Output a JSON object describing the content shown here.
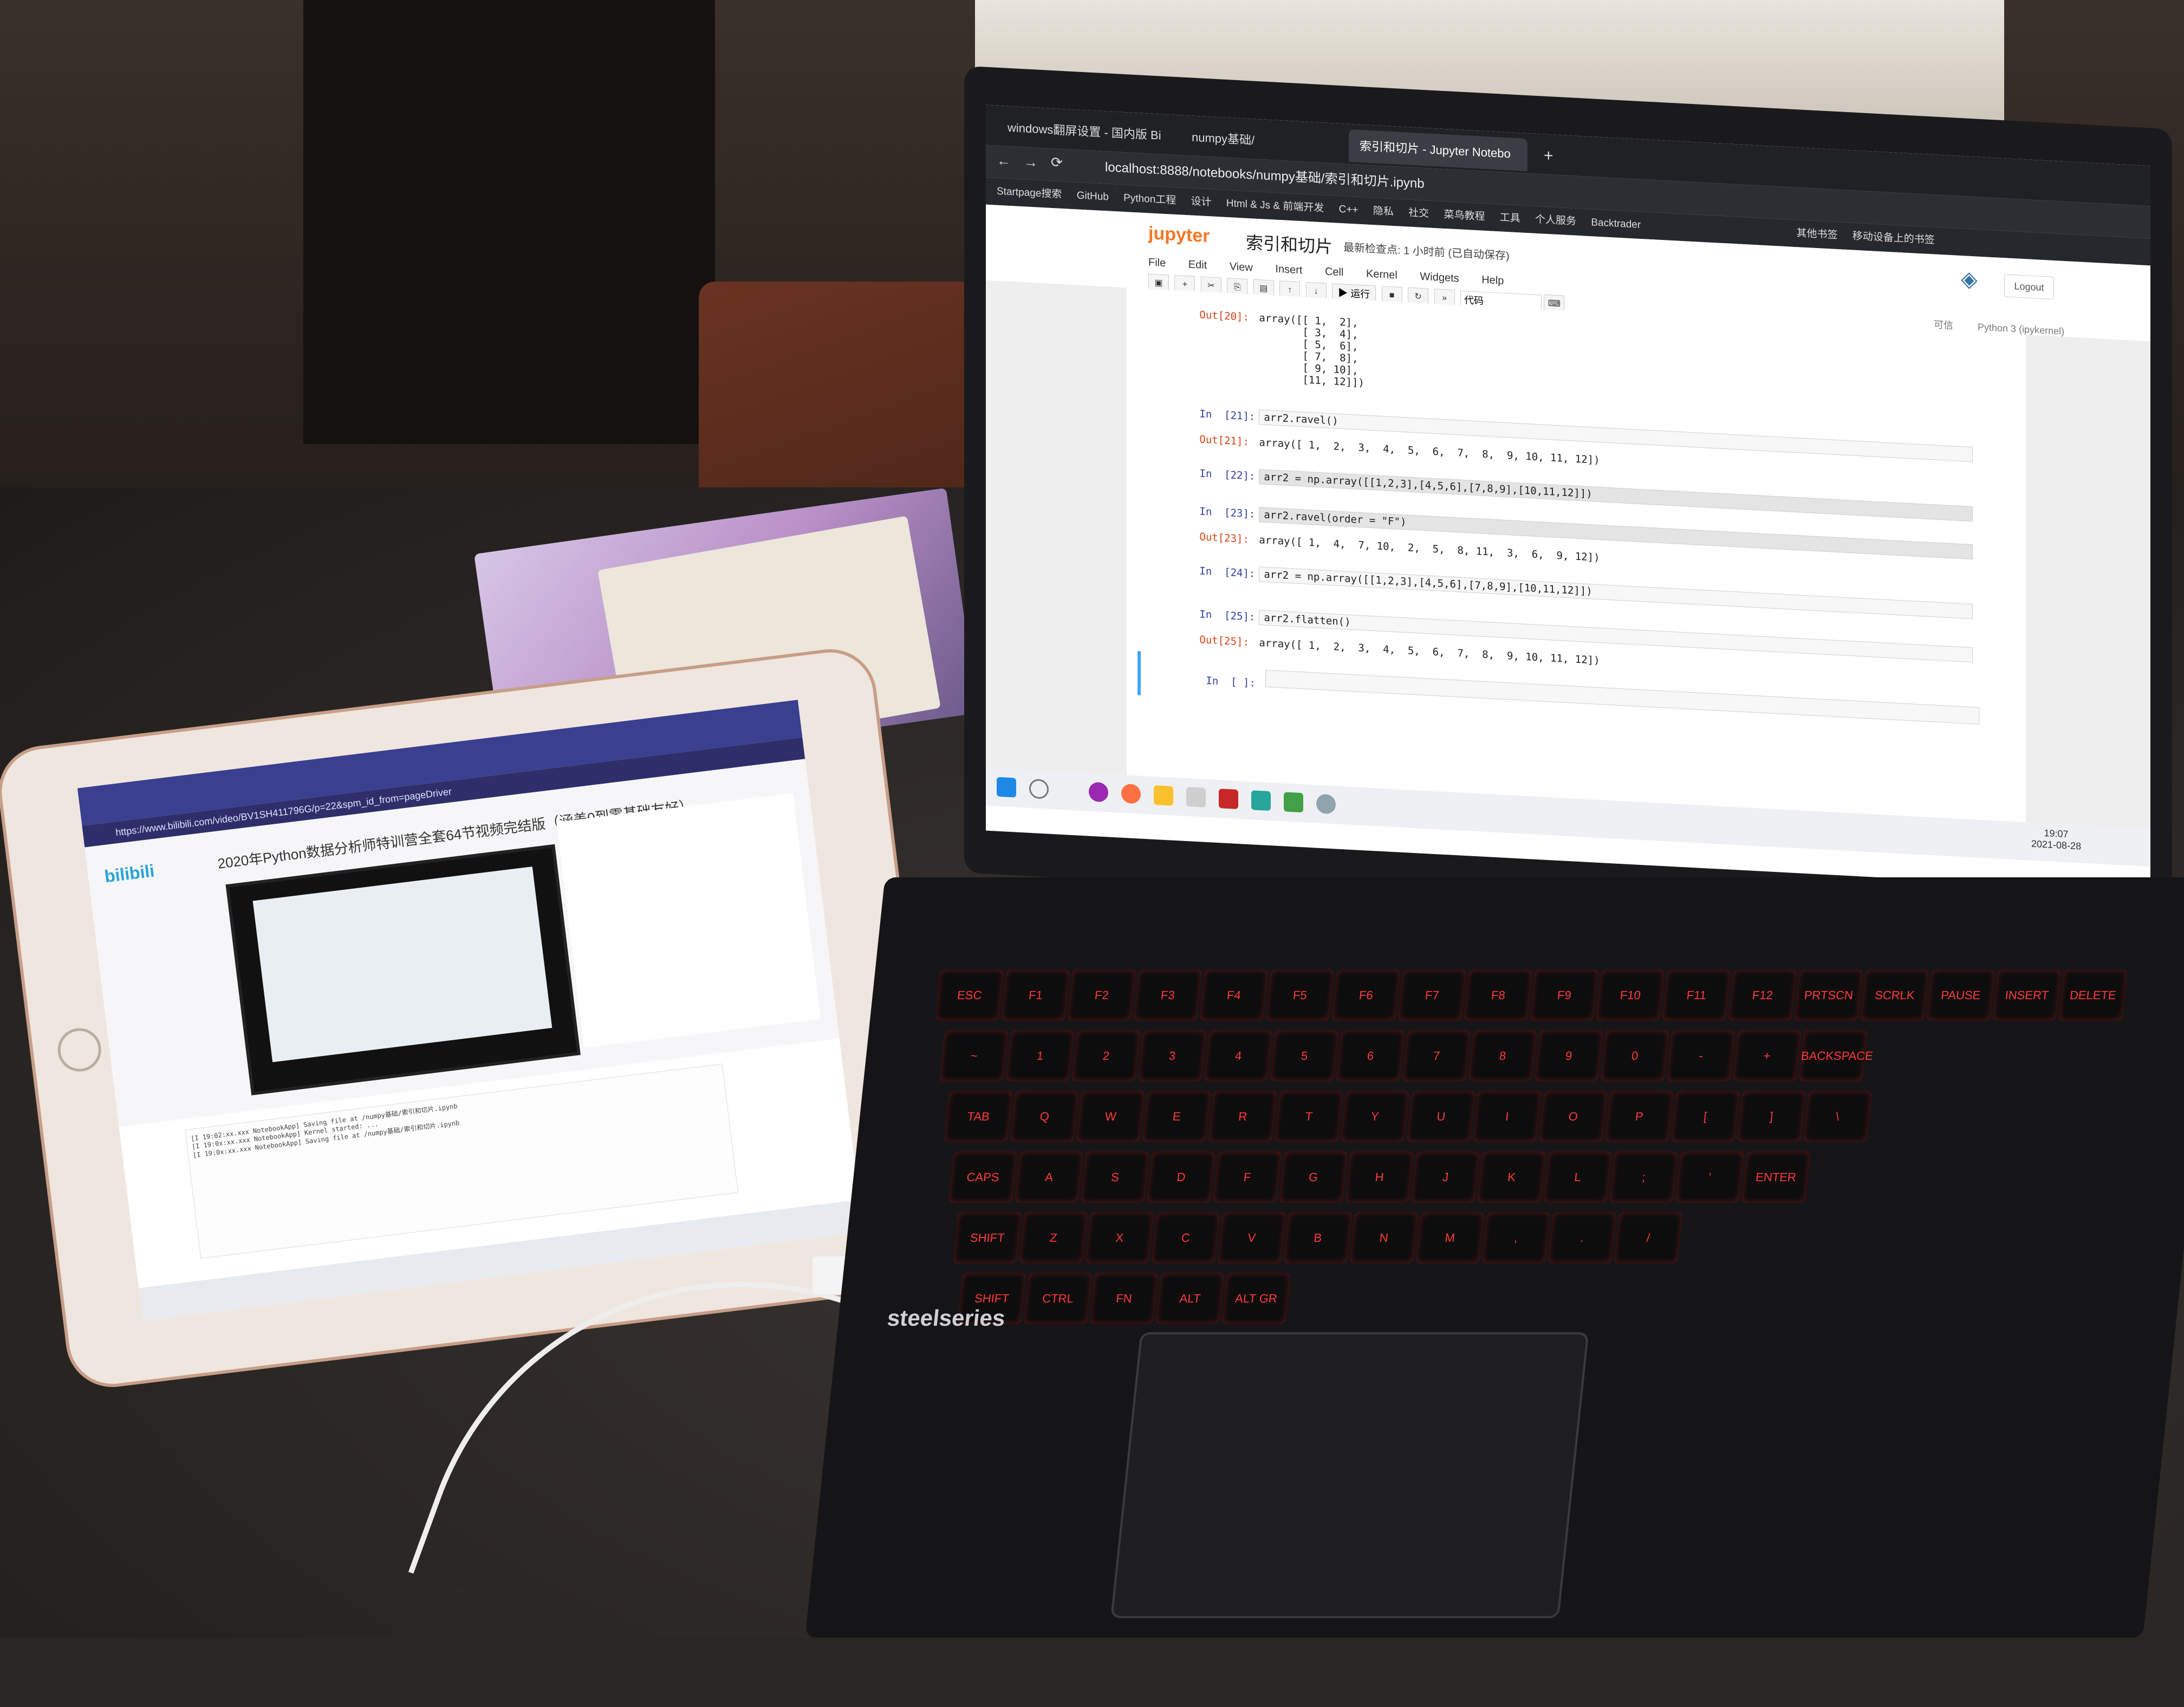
{
  "laptop": {
    "tabs": [
      {
        "label": "windows翻屏设置 - 国内版 Bi"
      },
      {
        "label": "numpy基础/"
      },
      {
        "label": "索引和切片 - Jupyter Notebo"
      }
    ],
    "url": "localhost:8888/notebooks/numpy基础/索引和切片.ipynb",
    "bookmarks": [
      "Startpage搜索",
      "GitHub",
      "Python工程",
      "设计",
      "Html & Js & 前端开发",
      "C++",
      "隐私",
      "社交",
      "菜鸟教程",
      "工具",
      "个人服务",
      "Backtrader"
    ],
    "bookmarks_right": [
      "其他书签",
      "移动设备上的书签"
    ],
    "jupyter": {
      "logo": "jupyter",
      "notebook_name": "索引和切片",
      "checkpoint": "最新检查点: 1 小时前  (已自动保存)",
      "logout": "Logout",
      "menu": [
        "File",
        "Edit",
        "View",
        "Insert",
        "Cell",
        "Kernel",
        "Widgets",
        "Help"
      ],
      "run_label": "运行",
      "cell_type": "代码",
      "trusted": "可信",
      "kernel": "Python 3 (ipykernel)"
    },
    "cells": [
      {
        "prompt": "Out[20]:",
        "kind": "out",
        "text": "array([[ 1,  2],\n       [ 3,  4],\n       [ 5,  6],\n       [ 7,  8],\n       [ 9, 10],\n       [11, 12]])"
      },
      {
        "prompt": "In  [21]:",
        "kind": "in",
        "text": "arr2.ravel()"
      },
      {
        "prompt": "Out[21]:",
        "kind": "out",
        "text": "array([ 1,  2,  3,  4,  5,  6,  7,  8,  9, 10, 11, 12])"
      },
      {
        "prompt": "In  [22]:",
        "kind": "in",
        "text": "arr2 = np.array([[1,2,3],[4,5,6],[7,8,9],[10,11,12]])"
      },
      {
        "prompt": "In  [23]:",
        "kind": "in",
        "text": "arr2.ravel(order = \"F\")"
      },
      {
        "prompt": "Out[23]:",
        "kind": "out",
        "text": "array([ 1,  4,  7, 10,  2,  5,  8, 11,  3,  6,  9, 12])"
      },
      {
        "prompt": "In  [24]:",
        "kind": "in",
        "text": "arr2 = np.array([[1,2,3],[4,5,6],[7,8,9],[10,11,12]])"
      },
      {
        "prompt": "In  [25]:",
        "kind": "in",
        "text": "arr2.flatten()"
      },
      {
        "prompt": "Out[25]:",
        "kind": "out",
        "text": "array([ 1,  2,  3,  4,  5,  6,  7,  8,  9, 10, 11, 12])"
      },
      {
        "prompt": "In  [ ]:",
        "kind": "in",
        "text": ""
      }
    ],
    "clock": {
      "time": "19:07",
      "date": "2021-08-28"
    },
    "brand": "steelseries",
    "keys": [
      "ESC",
      "F1",
      "F2",
      "F3",
      "F4",
      "F5",
      "F6",
      "F7",
      "F8",
      "F9",
      "F10",
      "F11",
      "F12",
      "PRTSCN",
      "SCRLK",
      "PAUSE",
      "INSERT",
      "DELETE",
      "~",
      "1",
      "2",
      "3",
      "4",
      "5",
      "6",
      "7",
      "8",
      "9",
      "0",
      "-",
      "+",
      "BACKSPACE",
      "TAB",
      "Q",
      "W",
      "E",
      "R",
      "T",
      "Y",
      "U",
      "I",
      "O",
      "P",
      "[",
      "]",
      "\\",
      "CAPS LOCK",
      "A",
      "S",
      "D",
      "F",
      "G",
      "H",
      "J",
      "K",
      "L",
      ";",
      "'",
      "ENTER",
      "SHIFT",
      "Z",
      "X",
      "C",
      "V",
      "B",
      "N",
      "M",
      ",",
      ".",
      "/",
      "SHIFT",
      "CTRL",
      "FN",
      "ALT",
      "ALT GR",
      "CTRL"
    ]
  },
  "tablet": {
    "address": "https://www.bilibili.com/video/BV1SH411796G/p=22&spm_id_from=pageDriver",
    "logo": "bilibili",
    "video_title": "2020年Python数据分析师特训营全套64节视频完结版（涵盖0到零基础友好）",
    "log_lines": [
      "[I 19:02:xx.xxx NotebookApp] Saving file at /numpy基础/索引和切片.ipynb",
      "[I 19:0x:xx.xxx NotebookApp] Kernel started: ...",
      "[I 19:0x:xx.xxx NotebookApp] Saving file at /numpy基础/索引和切片.ipynb"
    ]
  }
}
